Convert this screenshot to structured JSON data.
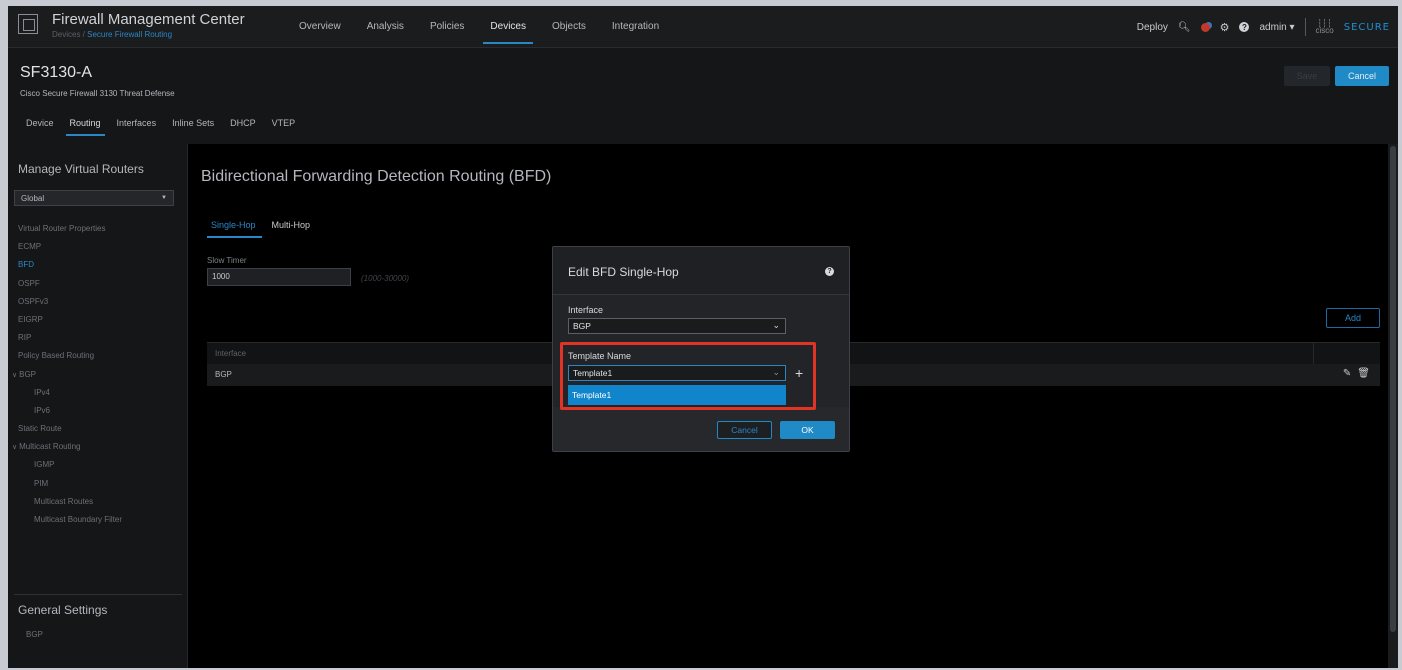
{
  "header": {
    "app_title": "Firewall Management Center",
    "crumb_prefix": "Devices / ",
    "crumb_current": "Secure Firewall Routing",
    "nav": [
      "Overview",
      "Analysis",
      "Policies",
      "Devices",
      "Objects",
      "Integration"
    ],
    "deploy": "Deploy",
    "user": "admin ▾",
    "brand_cisco": "cisco",
    "brand_secure": "SECURE"
  },
  "device": {
    "name": "SF3130-A",
    "subtitle": "Cisco Secure Firewall 3130 Threat Defense",
    "save": "Save",
    "cancel": "Cancel",
    "tabs": [
      "Device",
      "Routing",
      "Interfaces",
      "Inline Sets",
      "DHCP",
      "VTEP"
    ]
  },
  "sidebar": {
    "title": "Manage Virtual Routers",
    "router_select": "Global",
    "items": [
      "Virtual Router Properties",
      "ECMP",
      "BFD",
      "OSPF",
      "OSPFv3",
      "EIGRP",
      "RIP",
      "Policy Based Routing",
      "BGP",
      "IPv4",
      "IPv6",
      "Static Route",
      "Multicast Routing",
      "IGMP",
      "PIM",
      "Multicast Routes",
      "Multicast Boundary Filter"
    ],
    "general_title": "General Settings",
    "general_bgp": "BGP"
  },
  "main": {
    "title": "Bidirectional Forwarding Detection Routing (BFD)",
    "tabs": [
      "Single-Hop",
      "Multi-Hop"
    ],
    "slow_timer_label": "Slow Timer",
    "slow_timer_value": "1000",
    "slow_timer_hint": "(1000-30000)",
    "add": "Add",
    "table_header": "Interface",
    "rows": [
      {
        "interface": "BGP"
      }
    ]
  },
  "modal": {
    "title": "Edit BFD Single-Hop",
    "interface_label": "Interface",
    "interface_value": "BGP",
    "template_label": "Template Name",
    "template_value": "Template1",
    "dropdown_option": "Template1",
    "cancel": "Cancel",
    "ok": "OK"
  },
  "colors": {
    "accent": "#2b86c6",
    "highlight": "#e23327",
    "background": "#000000"
  }
}
